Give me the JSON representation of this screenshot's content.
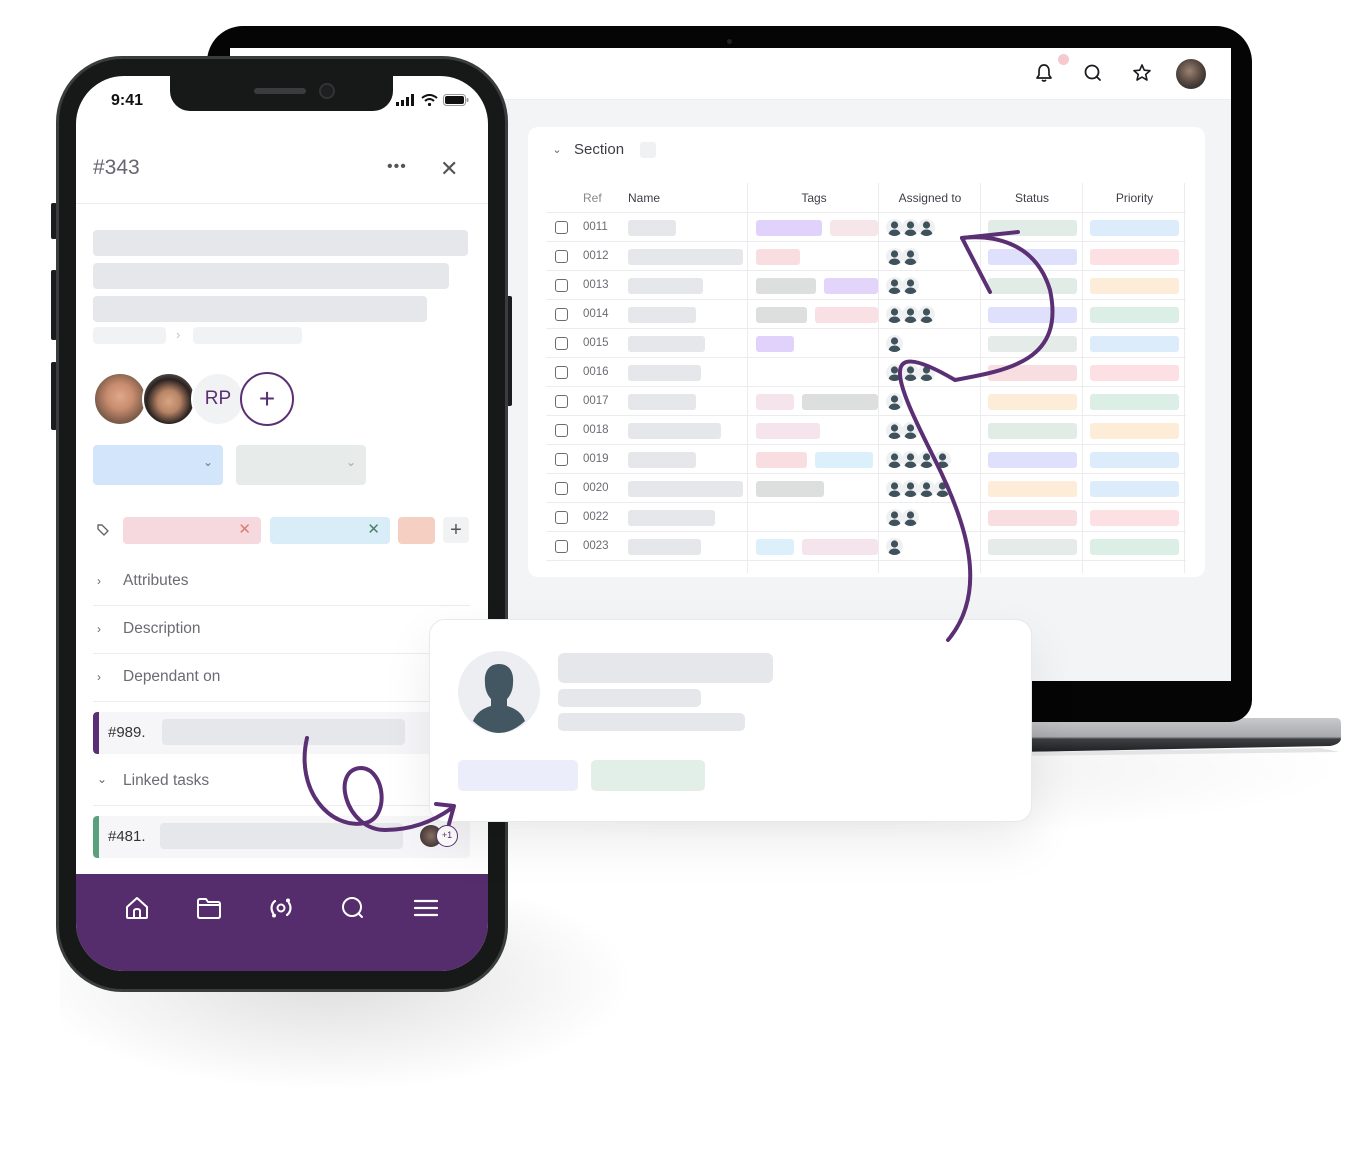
{
  "desktop": {
    "topbar": {
      "icons": [
        "bell-icon",
        "search-icon",
        "star-icon",
        "user-avatar"
      ],
      "notification_dot_color": "#f5c9cd"
    },
    "section": {
      "title": "Section",
      "columns": [
        "Ref",
        "Name",
        "Tags",
        "Assigned to",
        "Status",
        "Priority"
      ],
      "rows": [
        {
          "ref": "0011",
          "assignees": 3,
          "tags": [
            "#e0d2fb",
            "#f6e6ea"
          ],
          "status": "#e2ece6",
          "priority": "#dcecfb"
        },
        {
          "ref": "0012",
          "assignees": 2,
          "tags": [
            "#f8dde1"
          ],
          "status": "#dfe0fb",
          "priority": "#fde0e3"
        },
        {
          "ref": "0013",
          "assignees": 2,
          "tags": [
            "#dcdfde",
            "#e2d4fb"
          ],
          "status": "#e2ece6",
          "priority": "#fcecd8"
        },
        {
          "ref": "0014",
          "assignees": 3,
          "tags": [
            "#dcdfde",
            "#f8e0e4"
          ],
          "status": "#dfe0fb",
          "priority": "#dcefe6"
        },
        {
          "ref": "0015",
          "assignees": 1,
          "tags": [
            "#e0d2fb"
          ],
          "status": "#e5ebe8",
          "priority": "#dcecfb"
        },
        {
          "ref": "0016",
          "assignees": 3,
          "tags": [],
          "status": "#f8dde1",
          "priority": "#fde0e3"
        },
        {
          "ref": "0017",
          "assignees": 1,
          "tags": [
            "#f6e4ec",
            "#dcdfde"
          ],
          "status": "#fcecd8",
          "priority": "#dcefe6"
        },
        {
          "ref": "0018",
          "assignees": 2,
          "tags": [
            "#f6e4ec"
          ],
          "status": "#e2ece6",
          "priority": "#fcecd8"
        },
        {
          "ref": "0019",
          "assignees": 4,
          "tags": [
            "#f8dde1",
            "#dcf0fb"
          ],
          "status": "#dfe0fb",
          "priority": "#dcecfb"
        },
        {
          "ref": "0020",
          "assignees": 4,
          "tags": [
            "#dcdfde"
          ],
          "status": "#fcecd8",
          "priority": "#dcecfb"
        },
        {
          "ref": "0022",
          "assignees": 2,
          "tags": [],
          "status": "#f8dde1",
          "priority": "#fde0e3"
        },
        {
          "ref": "0023",
          "assignees": 1,
          "tags": [
            "#dcf0fb",
            "#f6e4ec"
          ],
          "status": "#e5ebe8",
          "priority": "#dcefe6"
        }
      ]
    }
  },
  "phone": {
    "status_bar": {
      "time": "9:41"
    },
    "task": {
      "id": "#343",
      "more_label": "•••",
      "close_label": "✕"
    },
    "assignees": {
      "initials": "RP",
      "add_label": "+"
    },
    "tags": {
      "remove_label": "✕",
      "add_label": "+"
    },
    "accordion": [
      {
        "label": "Attributes",
        "expanded": false
      },
      {
        "label": "Description",
        "expanded": false
      },
      {
        "label": "Dependant on",
        "expanded": false
      },
      {
        "label": "Linked tasks",
        "expanded": true
      }
    ],
    "dependant_item": {
      "id": "#989.",
      "stripe_color": "#5b2f74"
    },
    "linked_item": {
      "id": "#481.",
      "stripe_color": "#5aa07c",
      "extra_count": "+1"
    },
    "bottom_nav": [
      "home-icon",
      "folder-icon",
      "sync-icon",
      "search-icon",
      "menu-icon"
    ],
    "accent_color": "#552d6c"
  },
  "profile_card": {
    "avatar": "person-silhouette-icon",
    "buttons": [
      {
        "color": "#ecedfa"
      },
      {
        "color": "#e1efe8"
      }
    ]
  },
  "colors": {
    "brand_purple": "#5b2f74",
    "skeleton": "#e6e7ea"
  }
}
